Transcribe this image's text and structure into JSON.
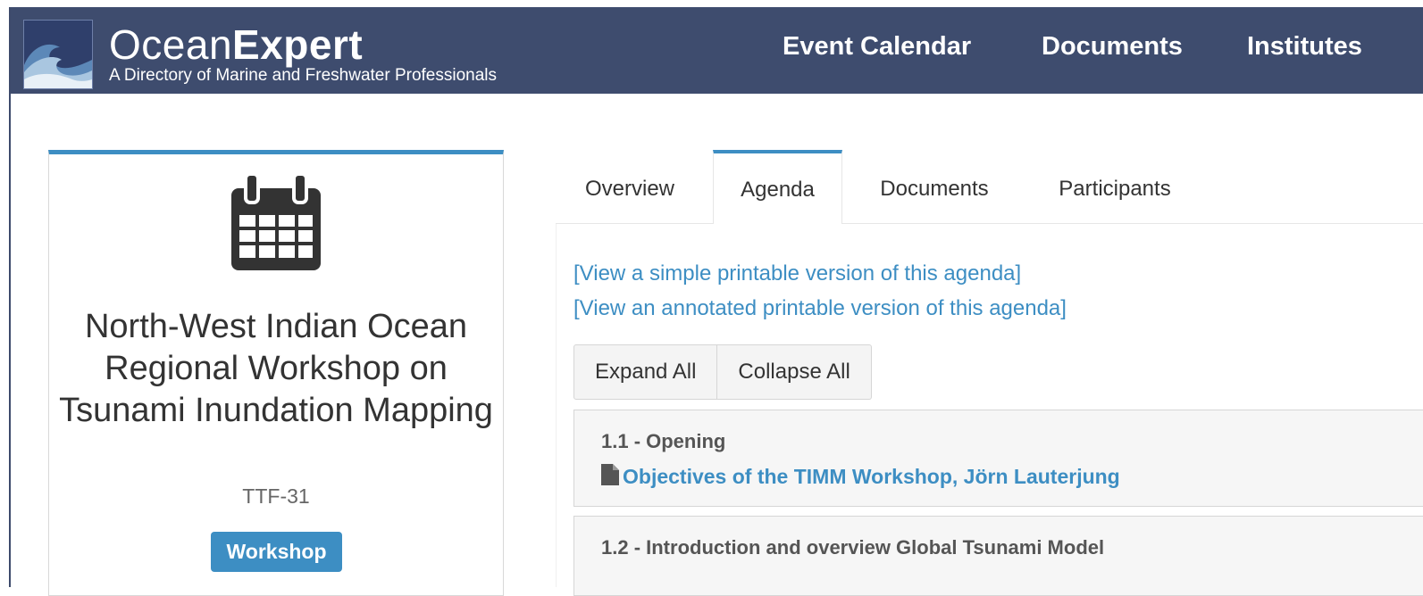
{
  "header": {
    "brand_light": "Ocean",
    "brand_bold": "Expert",
    "tagline": "A Directory of Marine and Freshwater Professionals",
    "nav": [
      "Event Calendar",
      "Documents",
      "Institutes"
    ],
    "logo_icon": "wave-logo-icon",
    "background_color": "#3e4c6e"
  },
  "event": {
    "icon": "calendar-icon",
    "title": "North-West Indian Ocean Regional Workshop on Tsunami Inundation Mapping",
    "code": "TTF-31",
    "type": "Workshop",
    "accent_color": "#3d8ec3"
  },
  "tabs": [
    {
      "label": "Overview",
      "active": false
    },
    {
      "label": "Agenda",
      "active": true
    },
    {
      "label": "Documents",
      "active": false
    },
    {
      "label": "Participants",
      "active": false
    }
  ],
  "agenda": {
    "simple_print_link": "[View a simple printable version of this agenda]",
    "annotated_print_link": "[View an annotated printable version of this agenda]",
    "expand_all": "Expand All",
    "collapse_all": "Collapse All",
    "items": [
      {
        "title": "1.1 - Opening",
        "documents": [
          {
            "icon": "file-icon",
            "label": "Objectives of the TIMM Workshop, Jörn Lauterjung"
          }
        ]
      },
      {
        "title": "1.2 - Introduction and overview Global Tsunami Model",
        "documents": []
      }
    ]
  }
}
